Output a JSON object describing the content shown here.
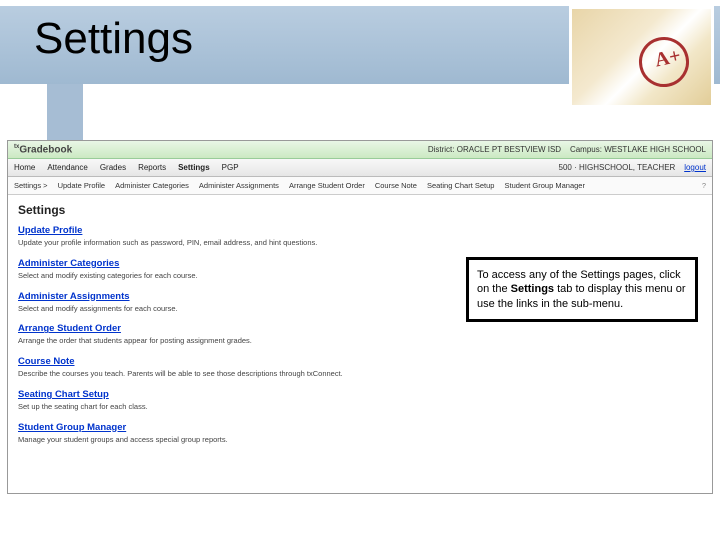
{
  "slide": {
    "title": "Settings"
  },
  "app": {
    "logo": "Gradebook",
    "topbar": {
      "district_label": "District:",
      "district": "ORACLE PT BESTVIEW ISD",
      "campus_label": "Campus:",
      "campus": "WESTLAKE HIGH SCHOOL"
    },
    "mainnav": {
      "items": [
        "Home",
        "Attendance",
        "Grades",
        "Reports",
        "Settings",
        "PGP"
      ],
      "right": "500 · HIGHSCHOOL, TEACHER",
      "logout": "logout"
    },
    "subnav": {
      "root": "Settings >",
      "items": [
        "Update Profile",
        "Administer Categories",
        "Administer Assignments",
        "Arrange Student Order",
        "Course Note",
        "Seating Chart Setup",
        "Student Group Manager"
      ],
      "help": "?"
    },
    "page_heading": "Settings",
    "sections": [
      {
        "title": "Update Profile",
        "desc": "Update your profile information such as password, PIN, email address, and hint questions."
      },
      {
        "title": "Administer Categories",
        "desc": "Select and modify existing categories for each course."
      },
      {
        "title": "Administer Assignments",
        "desc": "Select and modify assignments for each course."
      },
      {
        "title": "Arrange Student Order",
        "desc": "Arrange the order that students appear for posting assignment grades."
      },
      {
        "title": "Course Note",
        "desc": "Describe the courses you teach. Parents will be able to see those descriptions through txConnect."
      },
      {
        "title": "Seating Chart Setup",
        "desc": "Set up the seating chart for each class."
      },
      {
        "title": "Student Group Manager",
        "desc": "Manage your student groups and access special group reports."
      }
    ]
  },
  "callout": {
    "t1": "To access any of the Settings pages, click on the ",
    "bold": "Settings",
    "t2": " tab to display this menu or use the links in the sub-menu."
  }
}
